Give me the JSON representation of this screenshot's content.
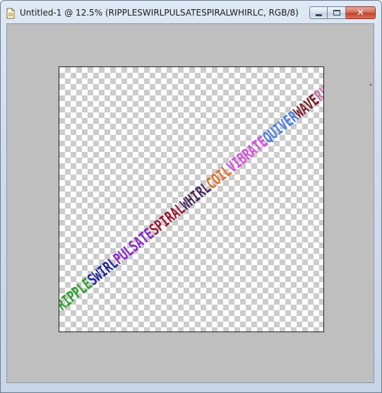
{
  "window": {
    "title": "Untitled-1 @ 12.5% (RIPPLESWIRLPULSATESPIRALWHIRLC, RGB/8)",
    "icon": "photoshop-document-icon",
    "controls": {
      "minimize_icon": "minimize-icon",
      "maximize_icon": "maximize-icon",
      "close_icon": "close-icon",
      "close_glyph": "✕"
    }
  },
  "canvas": {
    "background": "transparent-checkerboard",
    "text_words": [
      {
        "text": "RIPPLE",
        "color": "#2fa12f"
      },
      {
        "text": "SWIRL",
        "color": "#22269a"
      },
      {
        "text": "PULSATE",
        "color": "#8a28c8"
      },
      {
        "text": "SPIRAL",
        "color": "#9a1830"
      },
      {
        "text": "WHIRL",
        "color": "#4b2a5a"
      },
      {
        "text": "COIL",
        "color": "#e0702a"
      },
      {
        "text": "VIBRATE",
        "color": "#d44fd8"
      },
      {
        "text": "QUIVER",
        "color": "#4f7fe0"
      },
      {
        "text": "WAVE",
        "color": "#7a1f2a"
      },
      {
        "text": "RHYTHM",
        "color": "#c87aa8"
      }
    ]
  }
}
